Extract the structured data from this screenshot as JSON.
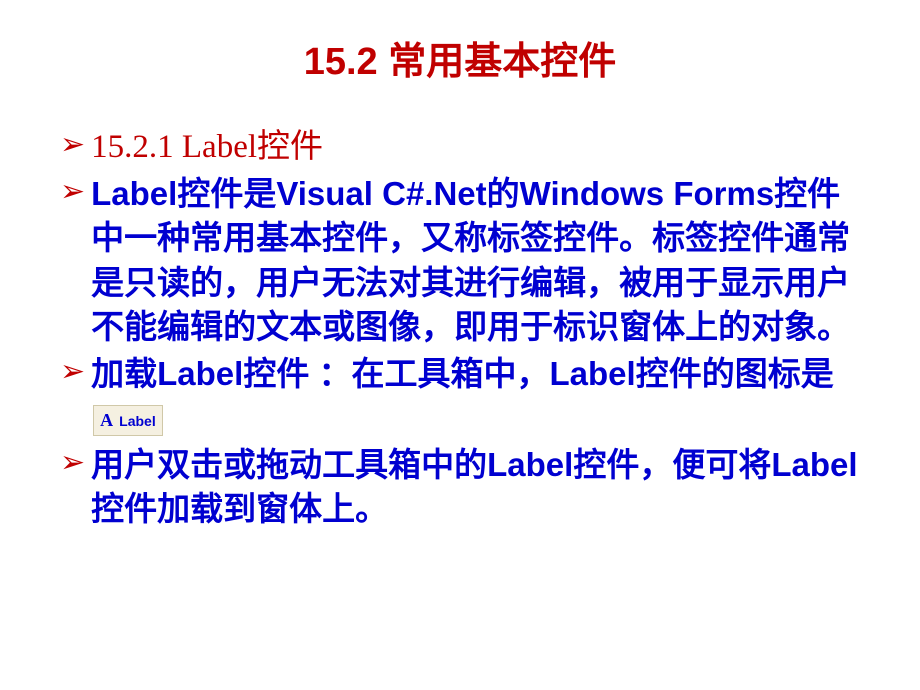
{
  "slide": {
    "title": "15.2  常用基本控件",
    "items": [
      {
        "text": "15.2.1  Label控件",
        "style": "red-thin"
      },
      {
        "text": "Label控件是Visual C#.Net的Windows Forms控件中一种常用基本控件，又称标签控件。标签控件通常是只读的，用户无法对其进行编辑，被用于显示用户不能编辑的文本或图像，即用于标识窗体上的对象。",
        "style": "blue-bold"
      },
      {
        "text_before": "加载Label控件 ：在工具箱中，Label控件的图标是",
        "icon_letter": "A",
        "icon_text": "Label",
        "style": "blue-bold",
        "has_icon": true
      },
      {
        "text": "用户双击或拖动工具箱中的Label控件，便可将Label控件加载到窗体上。",
        "style": "blue-bold"
      }
    ]
  }
}
